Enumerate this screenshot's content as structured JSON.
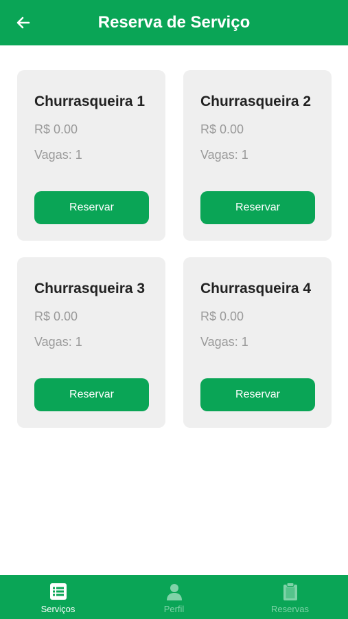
{
  "header": {
    "title": "Reserva de Serviço",
    "back_icon": "arrow-left-icon"
  },
  "services": [
    {
      "name": "Churrasqueira 1",
      "price": "R$ 0.00",
      "vagas": "Vagas: 1",
      "button_label": "Reservar"
    },
    {
      "name": "Churrasqueira 2",
      "price": "R$ 0.00",
      "vagas": "Vagas: 1",
      "button_label": "Reservar"
    },
    {
      "name": "Churrasqueira 3",
      "price": "R$ 0.00",
      "vagas": "Vagas: 1",
      "button_label": "Reservar"
    },
    {
      "name": "Churrasqueira 4",
      "price": "R$ 0.00",
      "vagas": "Vagas: 1",
      "button_label": "Reservar"
    }
  ],
  "bottom_nav": {
    "items": [
      {
        "label": "Serviços",
        "icon": "list-icon",
        "active": true
      },
      {
        "label": "Perfil",
        "icon": "person-icon",
        "active": false
      },
      {
        "label": "Reservas",
        "icon": "clipboard-icon",
        "active": false
      }
    ]
  },
  "colors": {
    "brand_green": "#0aa556",
    "card_background": "#efefef",
    "inactive_nav": "#7fd3a8"
  }
}
